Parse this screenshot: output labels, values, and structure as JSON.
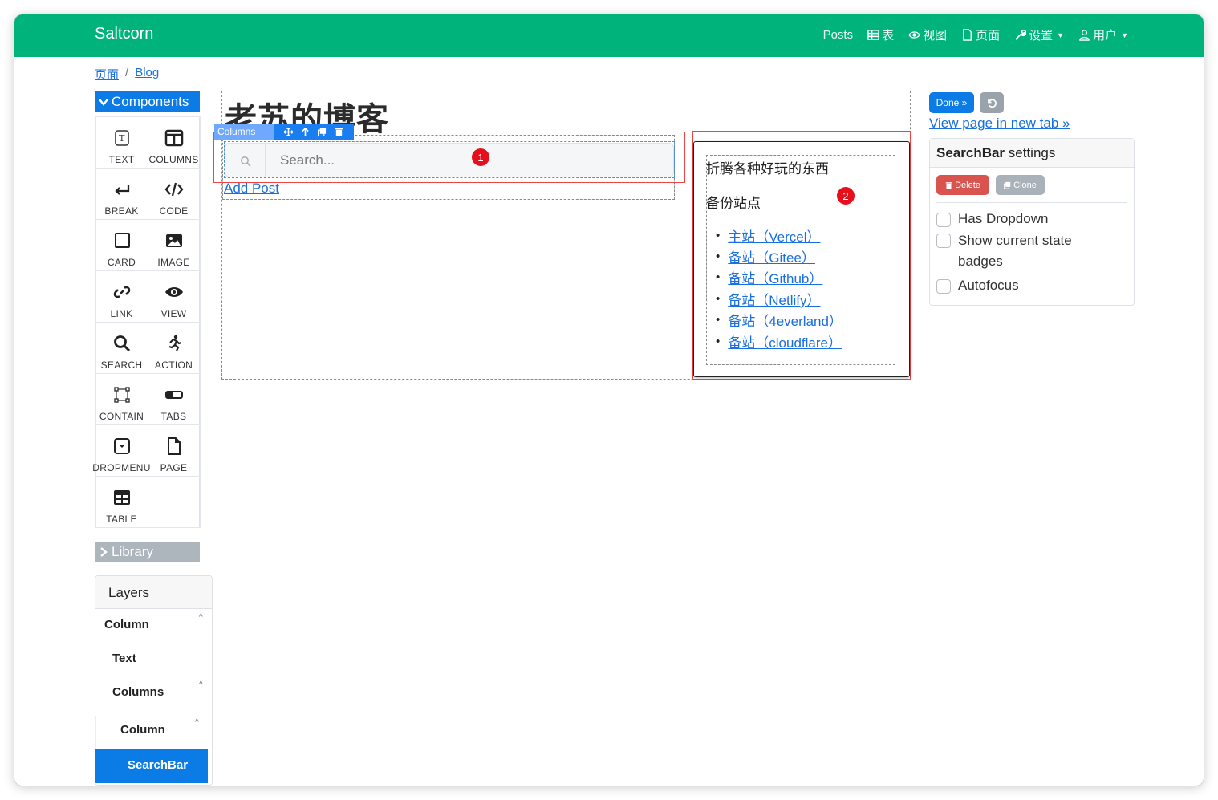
{
  "navbar": {
    "brand": "Saltcorn",
    "items": [
      {
        "label": "Posts",
        "icon": ""
      },
      {
        "label": "表",
        "icon": "table-icon"
      },
      {
        "label": "视图",
        "icon": "eye-icon"
      },
      {
        "label": "页面",
        "icon": "file-icon"
      },
      {
        "label": "设置",
        "icon": "wrench-icon",
        "dropdown": true
      },
      {
        "label": "用户",
        "icon": "user-icon",
        "dropdown": true
      }
    ]
  },
  "breadcrumb": {
    "pages": "页面",
    "separator": "/",
    "current": "Blog"
  },
  "palette": {
    "header": "Components",
    "items": [
      {
        "label": "TEXT",
        "icon": "text-icon"
      },
      {
        "label": "COLUMNS",
        "icon": "columns-icon"
      },
      {
        "label": "BREAK",
        "icon": "break-icon"
      },
      {
        "label": "CODE",
        "icon": "code-icon"
      },
      {
        "label": "CARD",
        "icon": "card-icon"
      },
      {
        "label": "IMAGE",
        "icon": "image-icon"
      },
      {
        "label": "LINK",
        "icon": "link-icon"
      },
      {
        "label": "VIEW",
        "icon": "eye-icon"
      },
      {
        "label": "SEARCH",
        "icon": "search-icon"
      },
      {
        "label": "ACTION",
        "icon": "running-icon"
      },
      {
        "label": "CONTAIN",
        "icon": "container-icon"
      },
      {
        "label": "TABS",
        "icon": "tabs-icon"
      },
      {
        "label": "DROPMENU",
        "icon": "dropdown-icon"
      },
      {
        "label": "PAGE",
        "icon": "page-icon"
      },
      {
        "label": "TABLE",
        "icon": "table-icon"
      }
    ],
    "library": "Library"
  },
  "layers": {
    "title": "Layers",
    "items": [
      "Column",
      "Text",
      "Columns",
      "Column"
    ],
    "selected": "SearchBar"
  },
  "canvas": {
    "page_title": "老苏的博客",
    "columns_tag": "Columns",
    "search_placeholder": "Search...",
    "add_post": "Add Post",
    "badge_1": "1",
    "badge_2": "2",
    "card_text_1": "折腾各种好玩的东西",
    "card_text_2": "备份站点",
    "sites": [
      "主站（Vercel）",
      "备站（Gitee）",
      "备站（Github）",
      "备站（Netlify）",
      "备站（4everland）",
      "备站（cloudflare）"
    ]
  },
  "right_panel": {
    "done": "Done »",
    "view_link": "View page in new tab »",
    "settings_name": "SearchBar",
    "settings_suffix": " settings",
    "delete": "Delete",
    "clone": "Clone",
    "checkboxes": [
      "Has Dropdown",
      "Show current state badges",
      "Autofocus"
    ]
  },
  "colors": {
    "navbar": "#00b37a",
    "primary": "#0d7be6",
    "danger": "#d9534f",
    "badge": "#e5101c"
  }
}
